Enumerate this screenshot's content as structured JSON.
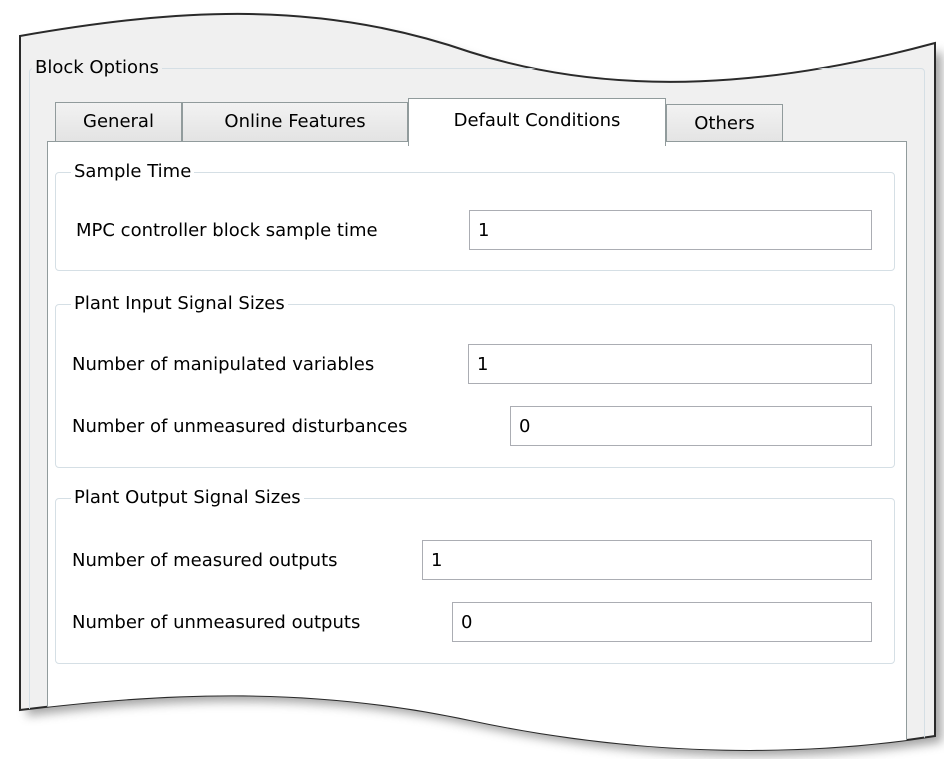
{
  "block_options": {
    "title": "Block Options",
    "tabs": [
      {
        "label": "General",
        "active": false
      },
      {
        "label": "Online Features",
        "active": false
      },
      {
        "label": "Default Conditions",
        "active": true
      },
      {
        "label": "Others",
        "active": false
      }
    ]
  },
  "sample_time": {
    "title": "Sample Time",
    "block_sample_time": {
      "label": "MPC controller block sample time",
      "value": "1"
    }
  },
  "plant_input": {
    "title": "Plant Input Signal Sizes",
    "manipulated_variables": {
      "label": "Number of manipulated variables",
      "value": "1"
    },
    "unmeasured_disturbances": {
      "label": "Number of unmeasured disturbances",
      "value": "0"
    }
  },
  "plant_output": {
    "title": "Plant Output Signal Sizes",
    "measured_outputs": {
      "label": "Number of measured outputs",
      "value": "1"
    },
    "unmeasured_outputs": {
      "label": "Number of unmeasured outputs",
      "value": "0"
    }
  }
}
